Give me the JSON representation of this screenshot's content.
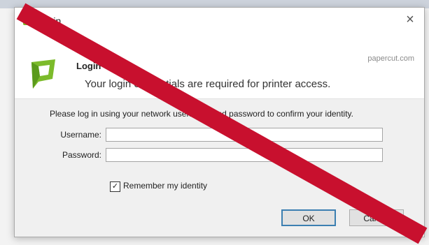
{
  "window": {
    "title": "Login",
    "close_glyph": "×"
  },
  "header": {
    "heading": "Login",
    "brand": "papercut.com",
    "subtext": "Your login credentials are required for printer access."
  },
  "form": {
    "instructions": "Please log in using your network username and password to confirm your identity.",
    "username_label": "Username:",
    "password_label": "Password:",
    "username_value": "",
    "password_value": "",
    "remember_label": "Remember my identity",
    "remember_checked": true,
    "check_glyph": "✓"
  },
  "buttons": {
    "ok": "OK",
    "cancel": "Cancel"
  },
  "overlay": {
    "icon": "red-strike-line",
    "color": "#c8102e"
  },
  "colors": {
    "logo_green": "#7cbb2b",
    "primary_border": "#3c7fb1"
  }
}
